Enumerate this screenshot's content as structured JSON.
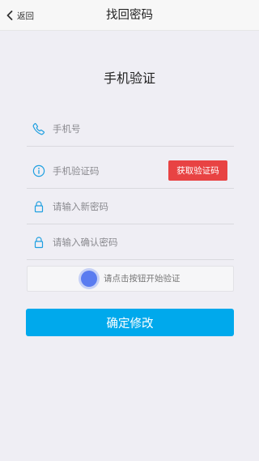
{
  "header": {
    "back_label": "返回",
    "title": "找回密码",
    "back_icon": "chevron-left-icon"
  },
  "form": {
    "section_title": "手机验证",
    "phone": {
      "placeholder": "手机号",
      "value": "",
      "icon": "phone-icon"
    },
    "code": {
      "placeholder": "手机验证码",
      "value": "",
      "icon": "info-icon",
      "button_label": "获取验证码"
    },
    "new_password": {
      "placeholder": "请输入新密码",
      "value": "",
      "icon": "lock-icon"
    },
    "confirm_password": {
      "placeholder": "请输入确认密码",
      "value": "",
      "icon": "lock-icon"
    },
    "verify": {
      "hint": "请点击按钮开始验证"
    },
    "submit_label": "确定修改"
  },
  "colors": {
    "accent": "#00a9ec",
    "danger": "#e84343",
    "icon": "#1e9fe0",
    "background": "#efeef4"
  }
}
